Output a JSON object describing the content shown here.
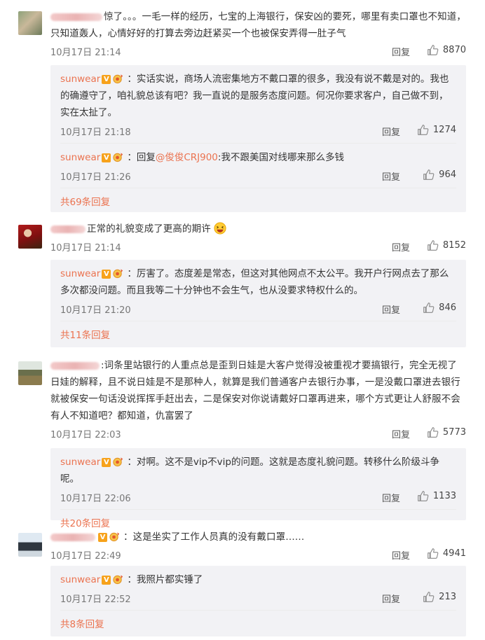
{
  "comments": [
    {
      "text": "惊了。。。一毛一样的经历，七宝的上海银行，保安凶的要死，哪里有卖口罩也不知道，只知道轰人，心情好好的打算去旁边赶紧买一个也被保安弄得一肚子气",
      "time": "10月17日 21:14",
      "reply": "回复",
      "likes": "8870",
      "replies": [
        {
          "user": "sunwear",
          "text": "实话实说，商场人流密集地方不戴口罩的很多，我没有说不戴是对的。我也的确遵守了，咱礼貌总该有吧？我一直说的是服务态度问题。何况你要求客户，自己做不到，实在太扯了。",
          "time": "10月17日 21:18",
          "reply": "回复",
          "likes": "1274"
        },
        {
          "user": "sunwear",
          "reply_prefix": "回复",
          "mention": "@俊俊CRJ900",
          "text": ":我不跟美国对线哪来那么多钱",
          "time": "10月17日 21:26",
          "reply": "回复",
          "likes": "964"
        }
      ],
      "more": "共69条回复"
    },
    {
      "text": "正常的礼貌变成了更高的期许",
      "time": "10月17日 21:14",
      "reply": "回复",
      "likes": "8152",
      "replies": [
        {
          "user": "sunwear",
          "text": "厉害了。态度差是常态，但这对其他网点不太公平。我开户行网点去了那么多次都没问题。而且我等二十分钟也不会生气，也从没要求特权什么的。",
          "time": "10月17日 21:20",
          "reply": "回复",
          "likes": "846"
        }
      ],
      "more": "共11条回复"
    },
    {
      "text": ":词条里站银行的人重点总是歪到日娃是大客户觉得没被重视才要搞银行，完全无视了日娃的解释，且不说日娃是不是那种人，就算是我们普通客户去银行办事，一是没戴口罩进去银行就被保安一句话没说挥挥手赶出去，二是保安对你说请戴好口罩再进来，哪个方式更让人舒服不会有人不知道吧？都知道，仇富罢了",
      "time": "10月17日 22:03",
      "reply": "回复",
      "likes": "5773",
      "replies": [
        {
          "user": "sunwear",
          "text": "对啊。这不是vip不vip的问题。这就是态度礼貌问题。转移什么阶级斗争呢。",
          "time": "10月17日 22:06",
          "reply": "回复",
          "likes": "1133"
        }
      ],
      "more": "共20条回复"
    },
    {
      "text": "这是坐实了工作人员真的没有戴口罩……",
      "time": "10月17日 22:49",
      "reply": "回复",
      "likes": "4941",
      "replies": [
        {
          "user": "sunwear",
          "text": "我照片都实锤了",
          "time": "10月17日 22:52",
          "reply": "回复",
          "likes": "213"
        }
      ],
      "more": "共8条回复"
    }
  ],
  "colors": {
    "link": "#eb7350",
    "reply_bg": "#f2f2f5",
    "text": "#333333",
    "meta": "#777777"
  },
  "icons": [
    "thumbs-up-icon",
    "verified-v-icon",
    "medal-icon",
    "laughing-emoji-icon"
  ]
}
